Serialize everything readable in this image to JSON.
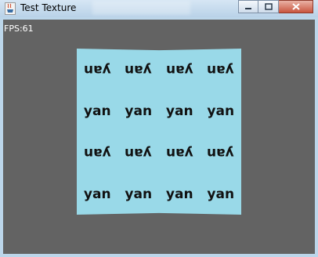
{
  "window": {
    "title": "Test Texture"
  },
  "hud": {
    "fps": "FPS:61"
  },
  "texture": {
    "background_color": "#99d9e8",
    "rows": [
      [
        "yan",
        "yan",
        "yan",
        "yan"
      ],
      [
        "yan",
        "yan",
        "yan",
        "yan"
      ],
      [
        "yan",
        "yan",
        "yan",
        "yan"
      ],
      [
        "yan",
        "yan",
        "yan",
        "yan"
      ]
    ],
    "flipped_rows": [
      true,
      false,
      true,
      false
    ]
  },
  "icons": {
    "app": "java-cup-icon",
    "minimize": "minimize-icon",
    "maximize": "maximize-icon",
    "close": "close-icon"
  }
}
